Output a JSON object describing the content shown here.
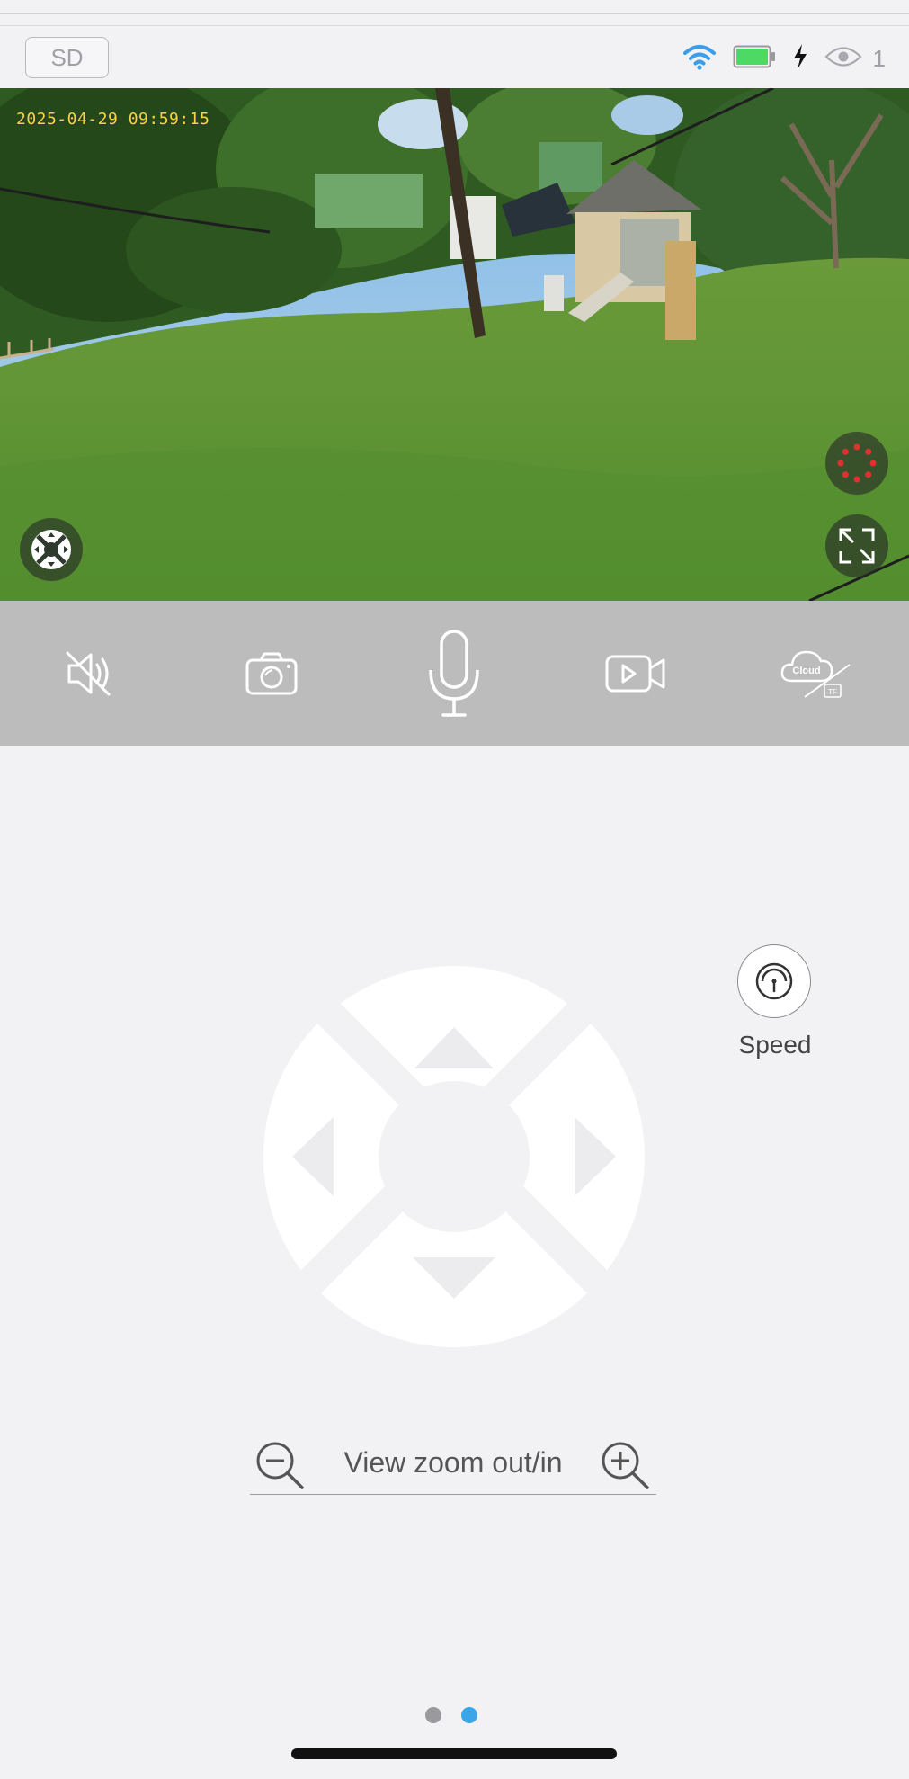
{
  "status_bar": {
    "sd_label": "SD",
    "viewer_count": "1",
    "icons": [
      "wifi-icon",
      "battery-icon",
      "charging-bolt-icon",
      "eye-icon"
    ],
    "wifi_color": "#3b9eea",
    "battery_color": "#4cd964"
  },
  "video": {
    "timestamp": "2025-04-29 09:59:15",
    "left_overlay_icon": "ptz-direction-icon",
    "right_overlay_icons": [
      "red-dot-ring-icon",
      "fullscreen-icon"
    ]
  },
  "controls": {
    "items": [
      "mute-icon",
      "snapshot-camera-icon",
      "microphone-icon",
      "record-video-icon",
      "cloud-tf-icon"
    ],
    "cloud_label": "Cloud",
    "tf_label": "TF"
  },
  "ptz": {
    "directions": [
      "up",
      "left",
      "right",
      "down"
    ]
  },
  "speed": {
    "label": "Speed"
  },
  "zoom": {
    "label": "View zoom out/in"
  },
  "pager": {
    "pages": 2,
    "active_index": 1,
    "active_color": "#3aa6e8",
    "inactive_color": "#9a9a9e"
  }
}
